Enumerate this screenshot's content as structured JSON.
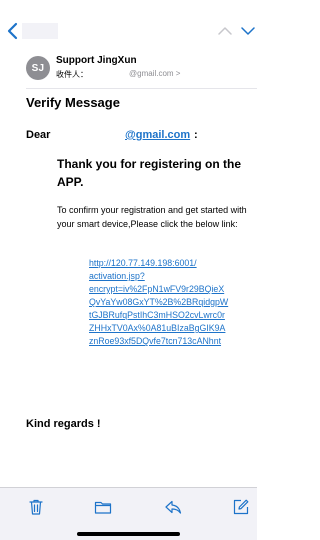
{
  "sender": {
    "initials": "SJ",
    "name": "Support JingXun",
    "to_label": "收件人：",
    "to_address": "@gmail.com >"
  },
  "message": {
    "subject": "Verify Message",
    "dear": "Dear",
    "recipient_email": "@gmail.com",
    "colon": ":",
    "thanks": "Thank you for registering on the APP.",
    "confirm": "To confirm your registration and get started with your smart device,Please click the below link:",
    "link_lines": [
      "http://120.77.149.198:6001/",
      "activation.jsp?",
      "encrypt=iv%2FpN1wFV9r29BQieX",
      "QvYaYw08GxYT%2B%2BRqidgpW",
      "tGJBRufqPstIhC3mHSO2cvLwrc0r",
      "ZHHxTV0Ax%0A81uBIzaBgGIK9A",
      "znRoe93xf5DQvfe7tcn713cANhnt"
    ],
    "regards": "Kind regards !"
  },
  "icons": {
    "back": "chevron-left-icon",
    "up": "chevron-up-icon",
    "down": "chevron-down-icon",
    "trash": "trash-icon",
    "folder": "folder-icon",
    "reply": "reply-icon",
    "compose": "compose-icon"
  },
  "colors": {
    "accent": "#1d73c9",
    "muted": "#8e8e93",
    "toolbar_bg": "#f2f2f7"
  }
}
